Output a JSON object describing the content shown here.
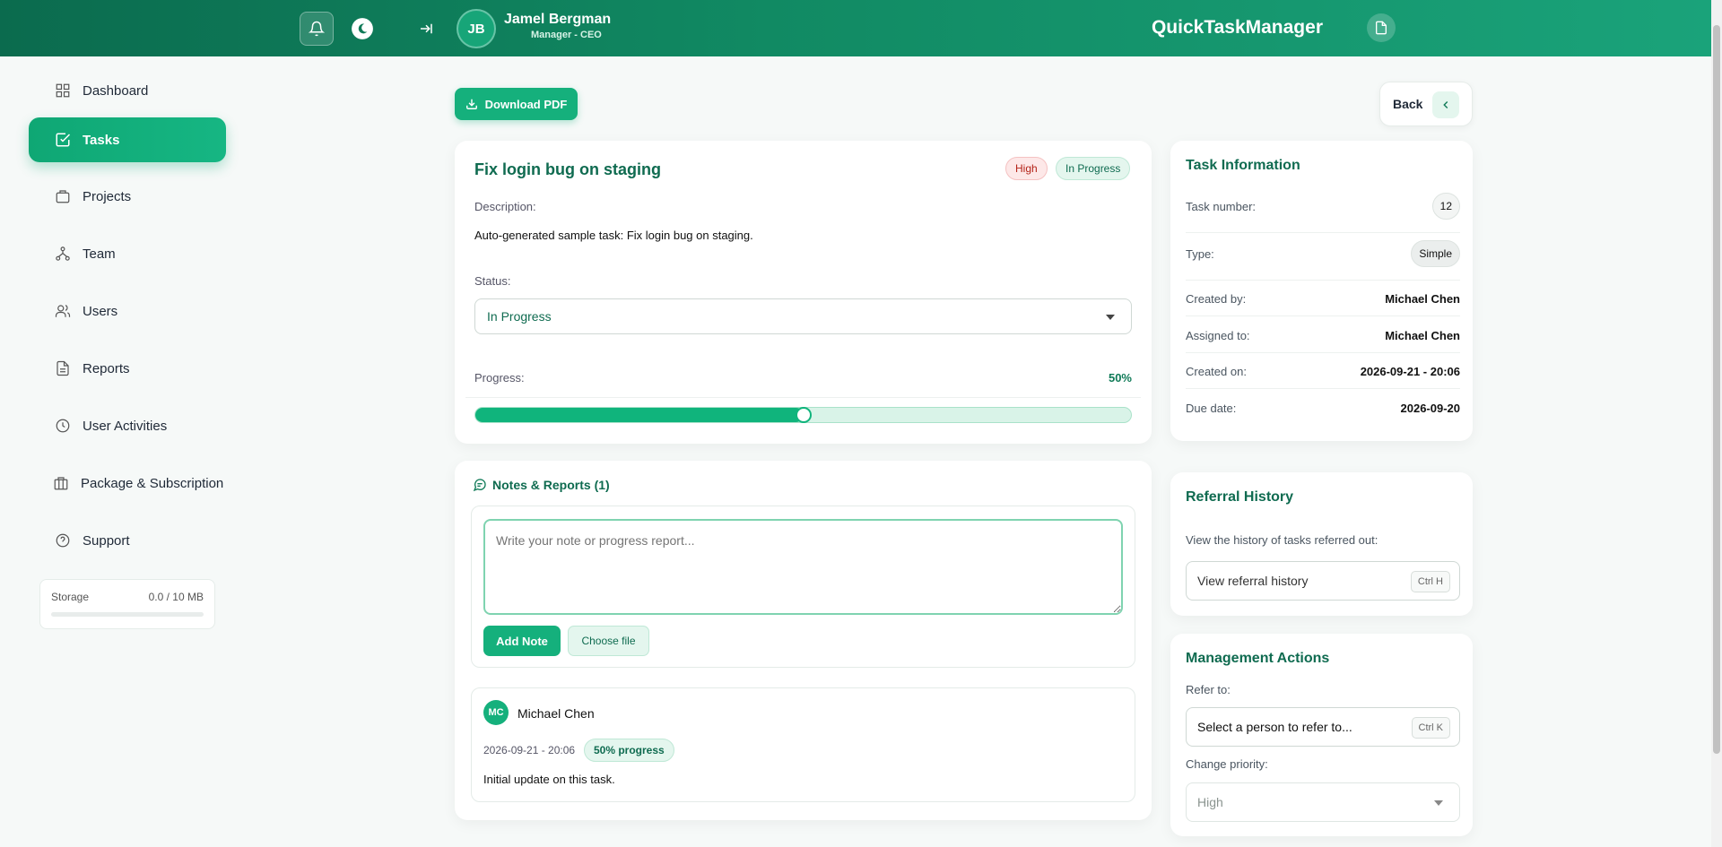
{
  "header": {
    "avatar_initials": "JB",
    "user_name": "Jamel Bergman",
    "user_role": "Manager - CEO",
    "brand": "QuickTaskManager",
    "icons": [
      "bell-icon",
      "moon-icon",
      "collapse-sidebar-icon",
      "document-icon"
    ]
  },
  "sidebar": {
    "items": [
      {
        "label": "Dashboard",
        "icon": "grid-icon"
      },
      {
        "label": "Tasks",
        "icon": "check-square-icon",
        "active": true
      },
      {
        "label": "Projects",
        "icon": "briefcase-icon"
      },
      {
        "label": "Team",
        "icon": "network-icon"
      },
      {
        "label": "Users",
        "icon": "users-icon"
      },
      {
        "label": "Reports",
        "icon": "file-text-icon"
      },
      {
        "label": "User Activities",
        "icon": "clock-icon"
      },
      {
        "label": "Package & Subscription",
        "icon": "package-icon"
      },
      {
        "label": "Support",
        "icon": "help-circle-icon"
      }
    ],
    "storage": {
      "label": "Storage",
      "value": "0.0 / 10 MB",
      "used_fraction": 0
    }
  },
  "toolbar": {
    "download_label": "Download PDF",
    "back_label": "Back"
  },
  "task": {
    "title": "Fix login bug on staging",
    "priority_badge": "High",
    "status_badge": "In Progress",
    "description_label": "Description:",
    "description": "Auto-generated sample task: Fix login bug on staging.",
    "status_label": "Status:",
    "status_value": "In Progress",
    "progress_label": "Progress:",
    "progress_text": "50%",
    "progress_value": 50
  },
  "notes": {
    "title": "Notes & Reports (1)",
    "placeholder": "Write your note or progress report...",
    "add_label": "Add Note",
    "file_label": "Choose file",
    "items": [
      {
        "initials": "MC",
        "author": "Michael Chen",
        "date": "2026-09-21 - 20:06",
        "badge": "50% progress",
        "text": "Initial update on this task."
      }
    ]
  },
  "info": {
    "title": "Task Information",
    "rows": [
      {
        "key": "Task number:",
        "value": "12"
      },
      {
        "key": "Type:",
        "value": "Simple"
      },
      {
        "key": "Created by:",
        "value": "Michael Chen"
      },
      {
        "key": "Assigned to:",
        "value": "Michael Chen"
      },
      {
        "key": "Created on:",
        "value": "2026-09-21 - 20:06"
      },
      {
        "key": "Due date:",
        "value": "2026-09-20"
      }
    ]
  },
  "referral": {
    "title": "Referral History",
    "subtitle": "View the history of tasks referred out:",
    "button_label": "View referral history",
    "shortcut": "Ctrl H"
  },
  "management": {
    "title": "Management Actions",
    "refer_label": "Refer to:",
    "refer_placeholder": "Select a person to refer to...",
    "refer_shortcut": "Ctrl K",
    "priority_label": "Change priority:",
    "priority_value": "High"
  },
  "colors": {
    "primary": "#15b07c",
    "header_start": "#0b6b4e",
    "heading": "#0f6b50"
  }
}
